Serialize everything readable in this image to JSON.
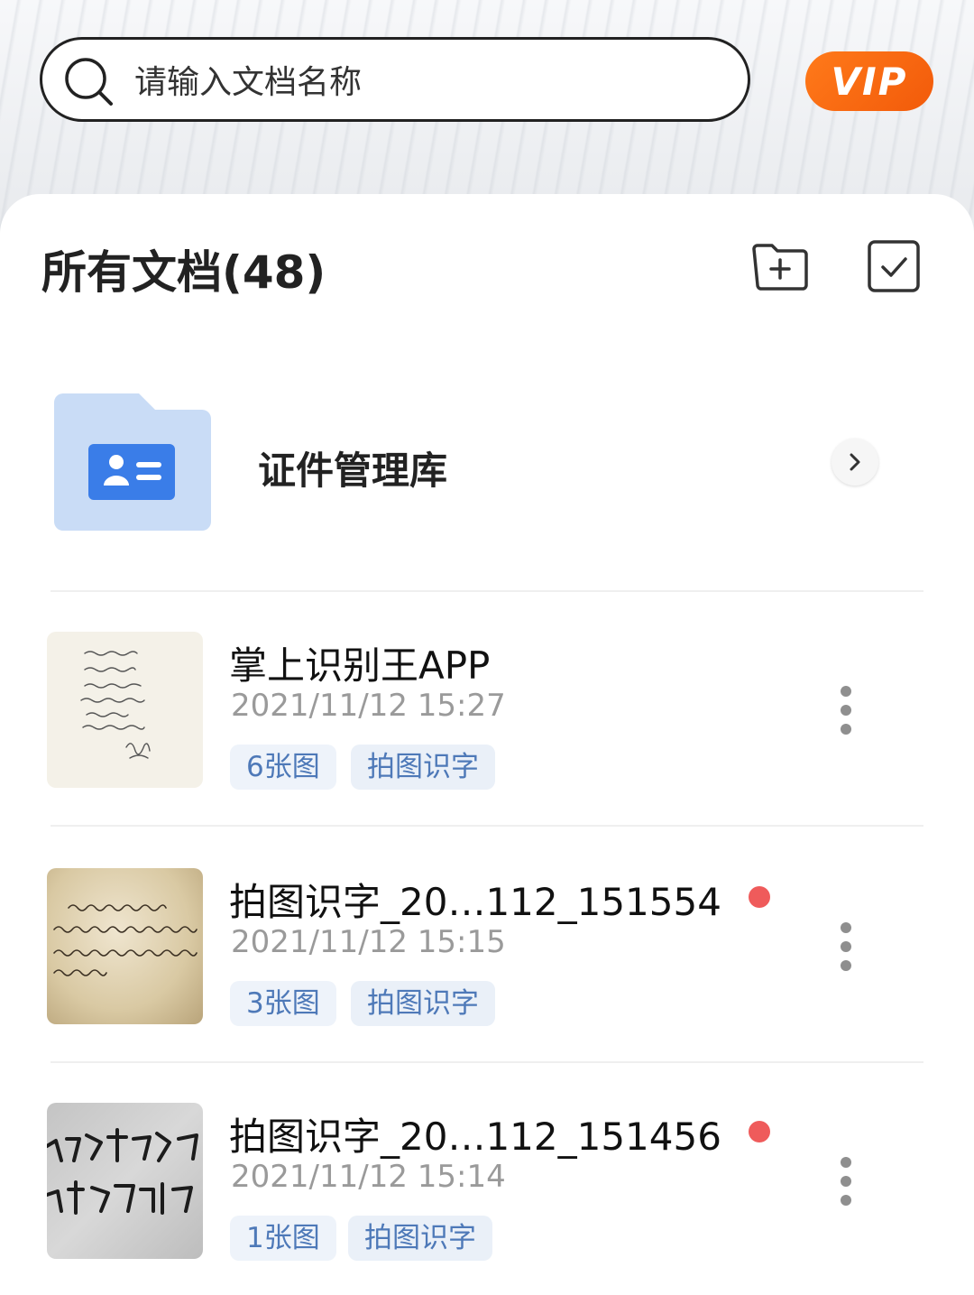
{
  "search": {
    "placeholder": "请输入文档名称"
  },
  "vip": {
    "label": "VIP"
  },
  "header": {
    "title": "所有文档(48)"
  },
  "folder": {
    "label": "证件管理库"
  },
  "documents": [
    {
      "title": "掌上识别王APP",
      "date": "2021/11/12 15:27",
      "count": "6张图",
      "type": "拍图识字",
      "unread": false,
      "thumb": "handwriting-note"
    },
    {
      "title": "拍图识字_20…112_151554",
      "date": "2021/11/12 15:15",
      "count": "3张图",
      "type": "拍图识字",
      "unread": true,
      "thumb": "calligraphy-paper"
    },
    {
      "title": "拍图识字_20…112_151456",
      "date": "2021/11/12 15:14",
      "count": "1张图",
      "type": "拍图识字",
      "unread": true,
      "thumb": "brush-calligraphy"
    }
  ],
  "colors": {
    "accent": "#4e79b8",
    "vip": "#f25a0a",
    "unread_dot": "#ef5b5b",
    "folder": "#c9dcf6"
  },
  "icons": [
    "search-icon",
    "new-folder-icon",
    "select-checkbox-icon",
    "id-card-folder-icon",
    "chevron-right-icon",
    "more-vertical-icon"
  ]
}
